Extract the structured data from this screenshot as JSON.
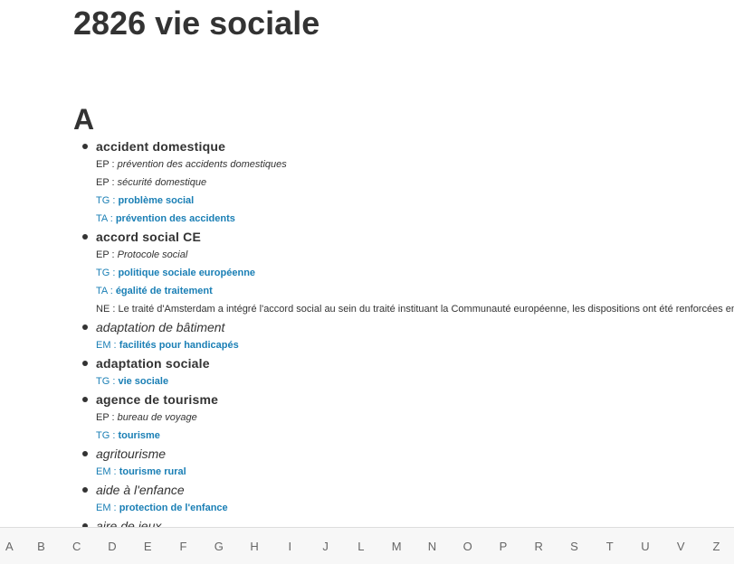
{
  "page": {
    "title": "2826 vie sociale"
  },
  "section": {
    "letter": "A"
  },
  "entries": [
    {
      "term": "accident domestique",
      "kind": "descriptor",
      "relations": [
        {
          "code": "EP :",
          "value": "prévention des accidents domestiques",
          "style": "text"
        },
        {
          "code": "EP :",
          "value": "sécurité domestique",
          "style": "text"
        },
        {
          "code": "TG :",
          "value": "problème social",
          "style": "link"
        },
        {
          "code": "TA :",
          "value": "prévention des accidents",
          "style": "link"
        }
      ]
    },
    {
      "term": "accord social CE",
      "kind": "descriptor",
      "relations": [
        {
          "code": "EP :",
          "value": "Protocole social",
          "style": "text"
        },
        {
          "code": "TG :",
          "value": "politique sociale européenne",
          "style": "link"
        },
        {
          "code": "TA :",
          "value": "égalité de traitement",
          "style": "link"
        },
        {
          "code": "NE :",
          "value": "Le traité d'Amsterdam a intégré l'accord social au sein du traité instituant la Communauté européenne, les dispositions ont été renforcées en m",
          "style": "note"
        }
      ]
    },
    {
      "term": "adaptation de bâtiment",
      "kind": "non-descriptor",
      "relations": [
        {
          "code": "EM :",
          "value": "facilités pour handicapés",
          "style": "link"
        }
      ]
    },
    {
      "term": "adaptation sociale",
      "kind": "descriptor",
      "relations": [
        {
          "code": "TG :",
          "value": "vie sociale",
          "style": "link"
        }
      ]
    },
    {
      "term": "agence de tourisme",
      "kind": "descriptor",
      "relations": [
        {
          "code": "EP :",
          "value": "bureau de voyage",
          "style": "text"
        },
        {
          "code": "TG :",
          "value": "tourisme",
          "style": "link"
        }
      ]
    },
    {
      "term": "agritourisme",
      "kind": "non-descriptor",
      "relations": [
        {
          "code": "EM :",
          "value": "tourisme rural",
          "style": "link"
        }
      ]
    },
    {
      "term": "aide à l'enfance",
      "kind": "non-descriptor",
      "relations": [
        {
          "code": "EM :",
          "value": "protection de l'enfance",
          "style": "link"
        }
      ]
    },
    {
      "term": "aire de jeux",
      "kind": "non-descriptor",
      "relations": []
    }
  ],
  "alphabet": [
    "A",
    "B",
    "C",
    "D",
    "E",
    "F",
    "G",
    "H",
    "I",
    "J",
    "L",
    "M",
    "N",
    "O",
    "P",
    "R",
    "S",
    "T",
    "U",
    "V",
    "Z"
  ]
}
